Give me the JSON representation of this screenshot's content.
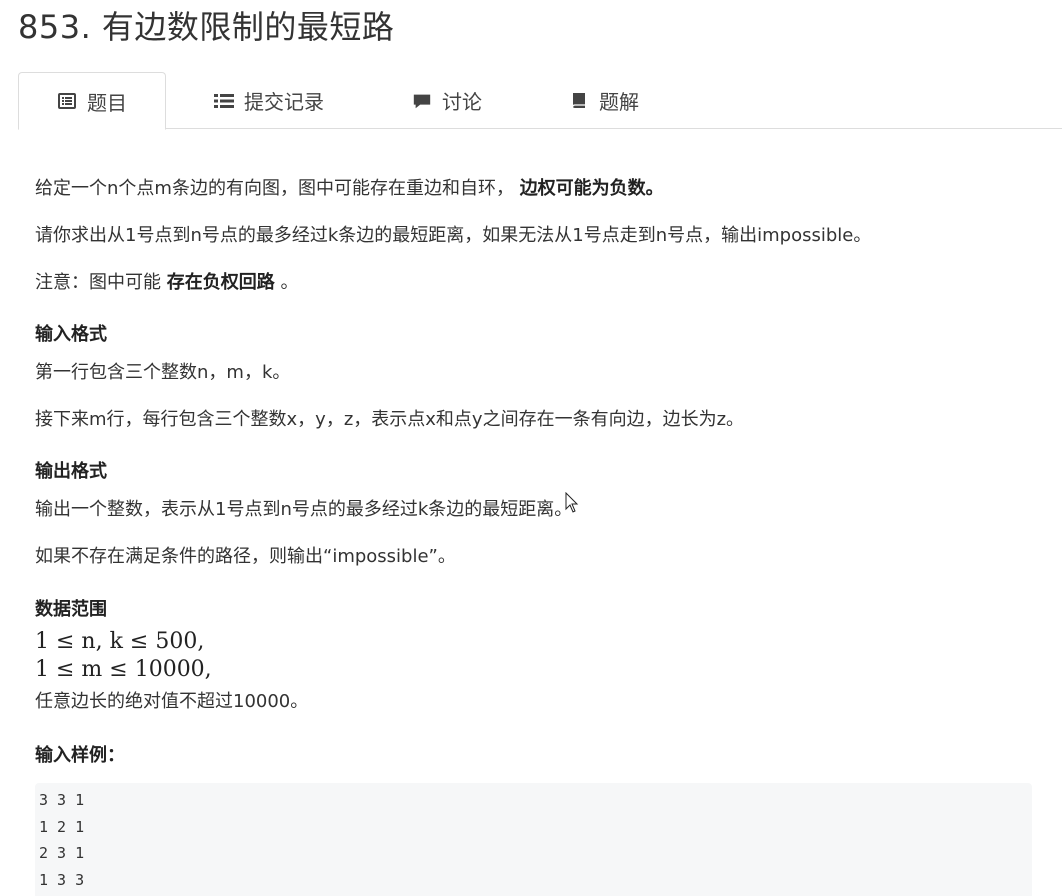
{
  "title": "853. 有边数限制的最短路",
  "tabs": [
    {
      "label": "题目",
      "icon": "list-alt-icon",
      "active": true
    },
    {
      "label": "提交记录",
      "icon": "list-icon",
      "active": false
    },
    {
      "label": "讨论",
      "icon": "comment-icon",
      "active": false
    },
    {
      "label": "题解",
      "icon": "book-icon",
      "active": false
    }
  ],
  "problem": {
    "intro_prefix": "给定一个n个点m条边的有向图，图中可能存在重边和自环，",
    "intro_bold": "边权可能为负数。",
    "task": "请你求出从1号点到n号点的最多经过k条边的最短距离，如果无法从1号点走到n号点，输出impossible。",
    "note_prefix": "注意：图中可能",
    "note_bold": "存在负权回路",
    "note_suffix": "。",
    "input_heading": "输入格式",
    "input_line1": "第一行包含三个整数n，m，k。",
    "input_line2": "接下来m行，每行包含三个整数x，y，z，表示点x和点y之间存在一条有向边，边长为z。",
    "output_heading": "输出格式",
    "output_line1": "输出一个整数，表示从1号点到n号点的最多经过k条边的最短距离。",
    "output_line2": "如果不存在满足条件的路径，则输出“impossible”。",
    "range_heading": "数据范围",
    "range_math1": "1 ≤ n, k ≤ 500,",
    "range_math2": "1 ≤ m ≤ 10000,",
    "range_text": "任意边长的绝对值不超过10000。",
    "sample_heading": "输入样例："
  },
  "sample_input": [
    "3 3 1",
    "1 2 1",
    "2 3 1",
    "1 3 3"
  ]
}
